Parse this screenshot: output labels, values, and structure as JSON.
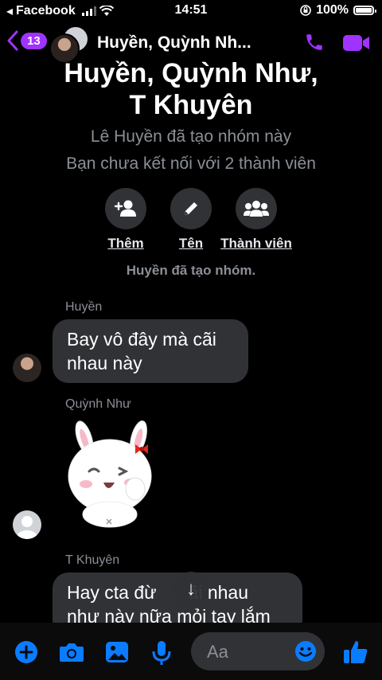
{
  "status_bar": {
    "carrier": "Facebook",
    "time": "14:51",
    "battery": "100%"
  },
  "header": {
    "badge_count": "13",
    "title": "Huyền, Quỳnh Nh..."
  },
  "group": {
    "name_line1": "Huyền, Quỳnh Như,",
    "name_line2": "T Khuyên",
    "created_by": "Lê Huyền đã tạo nhóm này",
    "not_connected": "Bạn chưa kết nối với 2 thành viên"
  },
  "actions": {
    "add": "Thêm",
    "name": "Tên",
    "members": "Thành viên"
  },
  "system_message": "Huyền đã tạo nhóm.",
  "messages": [
    {
      "sender": "Huyền",
      "line1": "Bay vô đây mà cãi",
      "line2": "nhau này"
    },
    {
      "sender": "Quỳnh Như"
    },
    {
      "sender": "T Khuyên",
      "line1": "Hay cta đừ",
      "line1b": "ãi nhau",
      "line2": "như này nữa mỏi tay lắm"
    }
  ],
  "composer": {
    "placeholder": "Aa"
  },
  "colors": {
    "accent": "#a033ff",
    "composer_blue": "#0a7cff",
    "bubble": "#303236",
    "muted_text": "#8b8f96"
  }
}
